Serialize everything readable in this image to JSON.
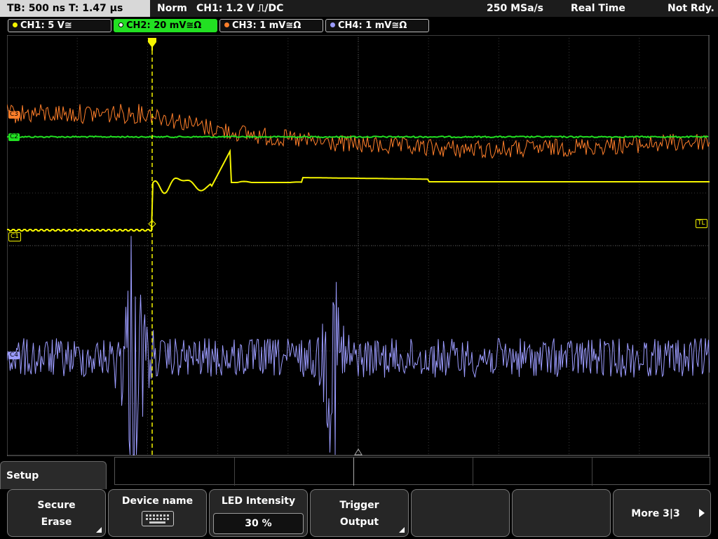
{
  "topbar": {
    "timebase": "TB: 500 ns   T: 1.47 µs",
    "mode": "Norm",
    "trigger": "CH1: 1.2 V ⎍/DC",
    "samplerate": "250 MSa/s",
    "acquisition": "Real Time",
    "status": "Not Rdy."
  },
  "channels": [
    {
      "label": "CH1: 5 V≅",
      "color": "#f5f500"
    },
    {
      "label": "CH2: 20 mV≅Ω",
      "color": "#22e022"
    },
    {
      "label": "CH3: 1 mV≅Ω",
      "color": "#ff7f2a"
    },
    {
      "label": "CH4: 1 mV≅Ω",
      "color": "#9c9cff"
    }
  ],
  "markers": {
    "c3": "C3",
    "c2": "C2",
    "c1": "C1",
    "c4": "C4",
    "tl": "TL"
  },
  "menu": {
    "title": "Setup",
    "keys": [
      {
        "l1": "Secure",
        "l2": "Erase"
      },
      {
        "l1": "Device name",
        "l2": ""
      },
      {
        "l1": "LED Intensity",
        "l2": "30 %"
      },
      {
        "l1": "Trigger",
        "l2": "Output"
      },
      {
        "l1": "",
        "l2": ""
      },
      {
        "l1": "",
        "l2": ""
      },
      {
        "l1": "More 3|3",
        "l2": ""
      }
    ]
  },
  "colors": {
    "ch1": "#f5f500",
    "ch2": "#22e022",
    "ch3": "#ff7f2a",
    "ch4": "#9c9cff",
    "grid": "#3a3a3a"
  },
  "icons": {
    "keyboard": "keyboard-icon",
    "more": "arrow-right-icon",
    "trigger": "trigger-marker-icon"
  }
}
